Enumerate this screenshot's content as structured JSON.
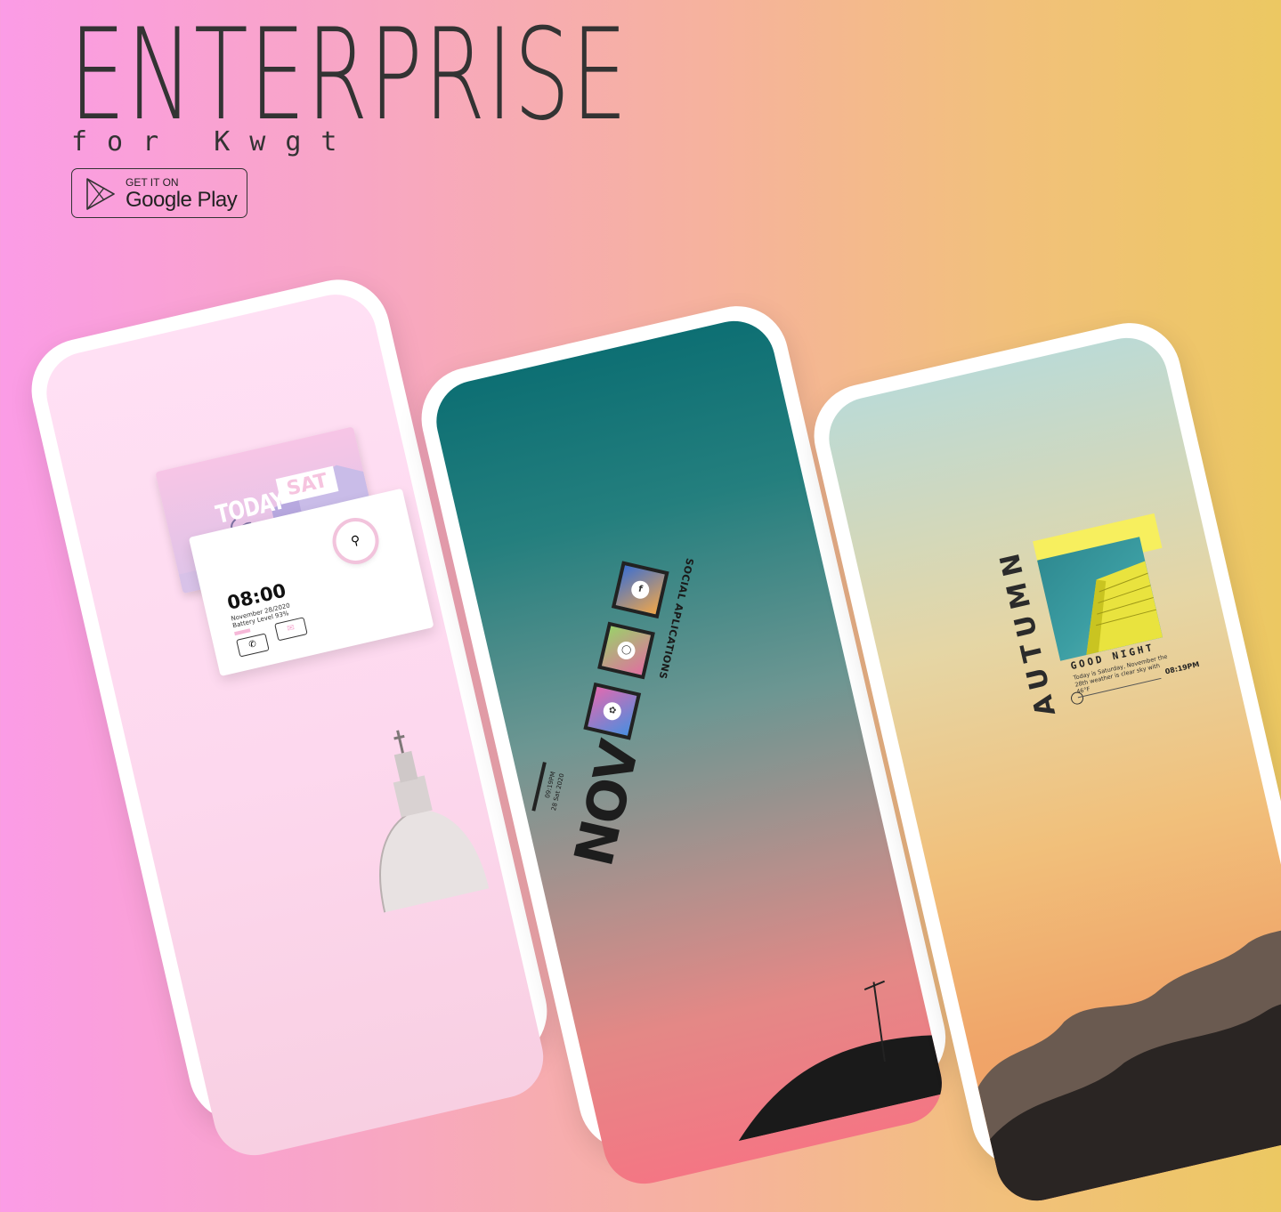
{
  "header": {
    "title": "ENTERPRISE",
    "subtitle": "for Kwgt",
    "badge": {
      "top_line": "GET IT ON",
      "store": "Google Play"
    }
  },
  "phones": {
    "pink": {
      "day_label": "TODAY",
      "day": "SAT",
      "time": "08:00",
      "date": "November 28/2020",
      "battery": "Battery Level 93%",
      "accent": "#f6b8d8"
    },
    "teal": {
      "title": "SOCIAL APLICATIONS",
      "apps": [
        "facebook",
        "instagram",
        "twitter"
      ],
      "month": "NOV",
      "meta_time": "09:19PM",
      "meta_date": "28 Sat 2020"
    },
    "sunset": {
      "season": "AUTUMN",
      "greeting": "GOOD NIGHT",
      "description": "Today is Saturday, November the 28th weather is clear sky with 46°F",
      "time": "08:19PM",
      "accent": "#f7ef5e"
    }
  },
  "colors": {
    "bg_left": "#fb9ce6",
    "bg_right": "#ecc862",
    "text": "#333333"
  }
}
